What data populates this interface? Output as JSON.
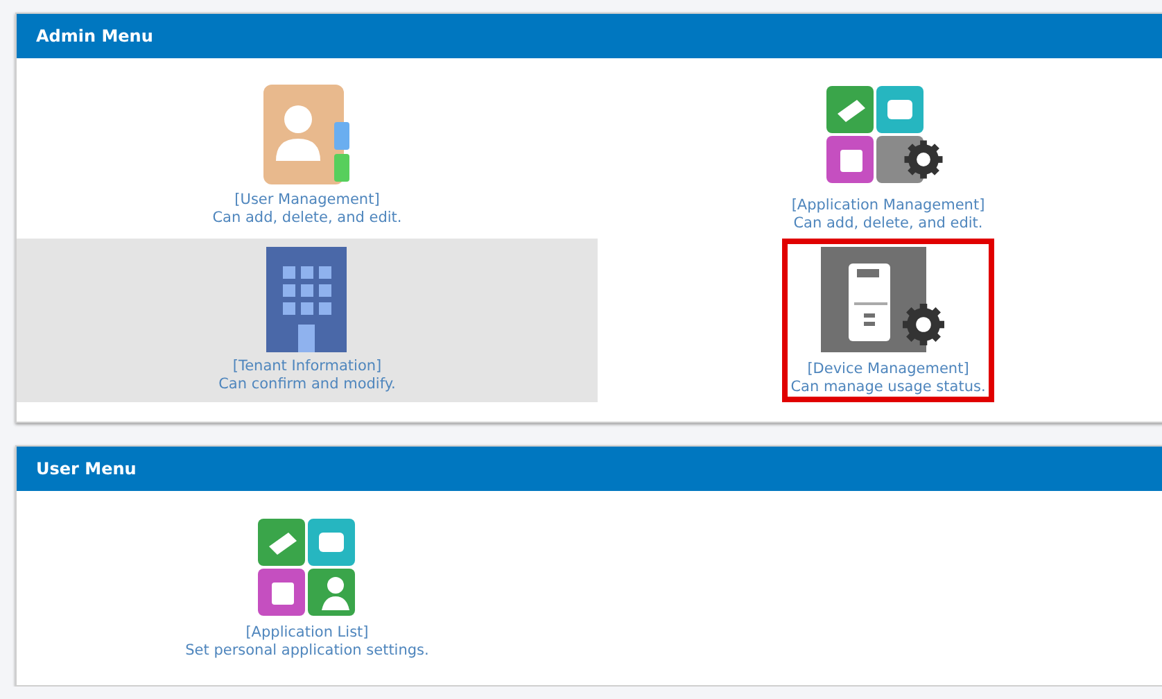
{
  "sections": [
    {
      "title": "Admin Menu",
      "items": [
        {
          "kind": "user",
          "title": "[User Management]",
          "description": "Can add, delete, and edit.",
          "highlighted": false,
          "outlined": false
        },
        {
          "kind": "apps",
          "title": "[Application Management]",
          "description": "Can add, delete, and edit.",
          "highlighted": false,
          "outlined": false
        },
        {
          "kind": "building",
          "title": "[Tenant Information]",
          "description": "Can confirm and modify.",
          "highlighted": true,
          "outlined": false
        },
        {
          "kind": "device",
          "title": "[Device Management]",
          "description": "Can manage usage status.",
          "highlighted": false,
          "outlined": true
        }
      ]
    },
    {
      "title": "User Menu",
      "items": [
        {
          "kind": "applist",
          "title": "[Application List]",
          "description": "Set personal application settings.",
          "highlighted": false,
          "outlined": false
        }
      ]
    }
  ]
}
